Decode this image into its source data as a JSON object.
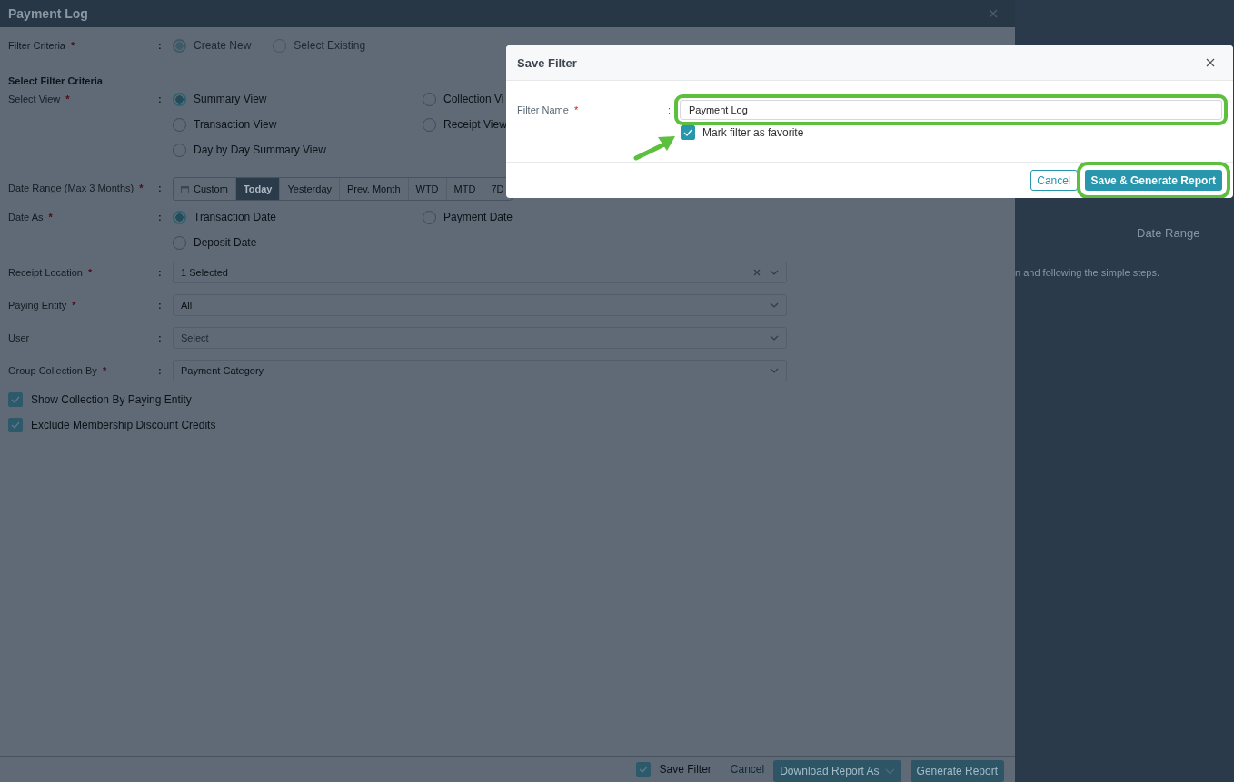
{
  "report": {
    "title": "Payment Log"
  },
  "separator": ":",
  "required_mark": "*",
  "filter_criteria": {
    "label": "Filter Criteria",
    "required": true,
    "disabled": true,
    "options": [
      {
        "label": "Create New",
        "selected": true
      },
      {
        "label": "Select Existing",
        "selected": false
      }
    ]
  },
  "section_title": "Select Filter Criteria",
  "select_view": {
    "label": "Select View",
    "required": true,
    "options": [
      {
        "label": "Summary View",
        "selected": true
      },
      {
        "label": "Collection Vi",
        "selected": false
      },
      {
        "label": "Transaction View",
        "selected": false
      },
      {
        "label": "Receipt View",
        "selected": false
      },
      {
        "label": "Day by Day Summary View",
        "selected": false
      }
    ]
  },
  "date_range": {
    "label": "Date Range (Max 3 Months)",
    "required": true,
    "presets": [
      {
        "label": "Custom",
        "selected": false,
        "kind": "calendar"
      },
      {
        "label": "Today",
        "selected": true,
        "kind": "plain"
      },
      {
        "label": "Yesterday",
        "selected": false,
        "kind": "plain"
      },
      {
        "label": "Prev. Month",
        "selected": false,
        "kind": "plain"
      },
      {
        "label": "WTD",
        "selected": false,
        "kind": "plain"
      },
      {
        "label": "MTD",
        "selected": false,
        "kind": "plain"
      },
      {
        "label": "7D",
        "selected": false,
        "kind": "plain"
      }
    ]
  },
  "date_as": {
    "label": "Date As",
    "required": true,
    "options": [
      {
        "label": "Transaction Date",
        "selected": true
      },
      {
        "label": "Payment Date",
        "selected": false
      },
      {
        "label": "Deposit Date",
        "selected": false
      }
    ]
  },
  "selects": [
    {
      "label": "Receipt Location",
      "required": true,
      "value": "1 Selected",
      "clearable": true
    },
    {
      "label": "Paying Entity",
      "required": true,
      "value": "All",
      "clearable": false
    },
    {
      "label": "User",
      "required": false,
      "placeholder": "Select",
      "clearable": false
    },
    {
      "label": "Group Collection By",
      "required": true,
      "value": "Payment Category",
      "clearable": false
    }
  ],
  "checks": [
    {
      "label": "Show Collection By Paying Entity",
      "checked": true
    },
    {
      "label": "Exclude Membership Discount Credits",
      "checked": true
    }
  ],
  "footer": {
    "save_filter": {
      "label": "Save Filter",
      "checked": true
    },
    "cancel": "Cancel",
    "download": "Download Report As",
    "generate": "Generate Report"
  },
  "side_help": {
    "heading": "Date Range",
    "text": "n and following the simple steps."
  },
  "dialog": {
    "title": "Save Filter",
    "field": {
      "label": "Filter Name",
      "required": true,
      "value": "Payment Log"
    },
    "favorite": {
      "label": "Mark filter as favorite",
      "checked": true
    },
    "cancel": "Cancel",
    "submit": "Save & Generate Report"
  }
}
